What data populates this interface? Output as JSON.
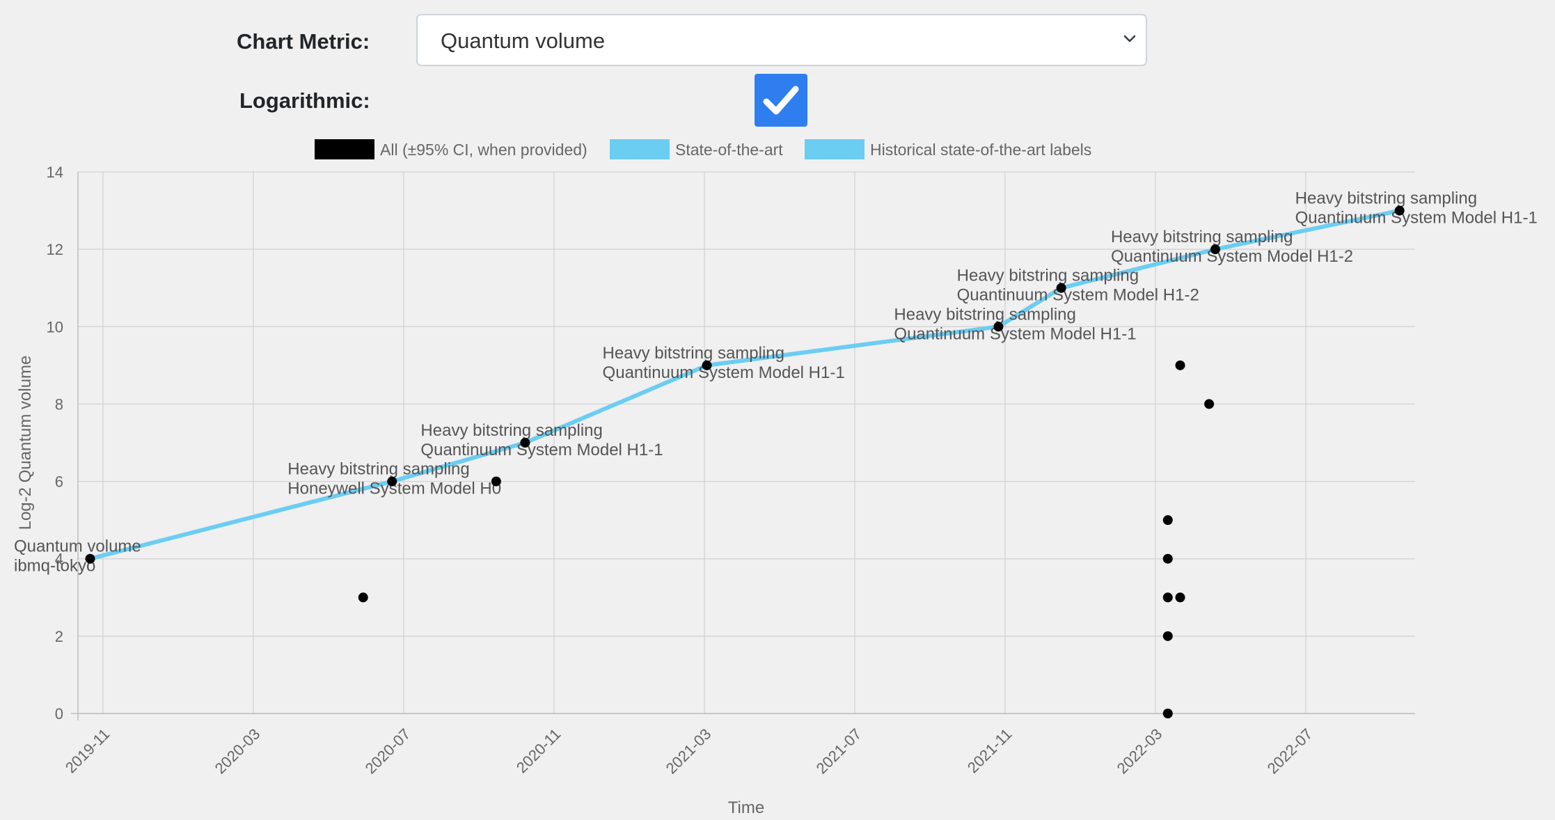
{
  "controls": {
    "metric_label": "Chart Metric:",
    "metric_value": "Quantum volume",
    "log_label": "Logarithmic:",
    "log_checked": true
  },
  "icons": {
    "select_caret": "chevron-down-icon",
    "checkbox": "check-icon"
  },
  "colors": {
    "sota": "#6ccdf2",
    "points": "#000000",
    "background": "#f0f0f0",
    "checkbox": "#2f7ef0"
  },
  "chart_data": {
    "type": "scatter",
    "xlabel": "Time",
    "ylabel": "Log-2 Quantum volume",
    "ylim": [
      0,
      14
    ],
    "yticks": [
      "0",
      "2",
      "4",
      "6",
      "8",
      "10",
      "12",
      "14"
    ],
    "xticks": [
      "2019-11",
      "2020-03",
      "2020-07",
      "2020-11",
      "2021-03",
      "2021-07",
      "2021-11",
      "2022-03",
      "2022-07"
    ],
    "grid": true,
    "legend": {
      "position": "top",
      "entries": [
        "All (±95% CI, when provided)",
        "State-of-the-art",
        "Historical state-of-the-art labels"
      ]
    },
    "series": [
      {
        "name": "All (±95% CI, when provided)",
        "points": [
          {
            "x": "2019-10-21",
            "y": 4
          },
          {
            "x": "2020-05-29",
            "y": 3
          },
          {
            "x": "2020-06-22",
            "y": 6
          },
          {
            "x": "2020-09-15",
            "y": 6
          },
          {
            "x": "2020-10-08",
            "y": 7
          },
          {
            "x": "2021-03-03",
            "y": 9
          },
          {
            "x": "2021-10-26",
            "y": 10
          },
          {
            "x": "2021-12-16",
            "y": 11
          },
          {
            "x": "2022-03-11",
            "y": 0
          },
          {
            "x": "2022-03-11",
            "y": 2
          },
          {
            "x": "2022-03-11",
            "y": 3
          },
          {
            "x": "2022-03-11",
            "y": 4
          },
          {
            "x": "2022-03-11",
            "y": 5
          },
          {
            "x": "2022-03-21",
            "y": 3
          },
          {
            "x": "2022-03-21",
            "y": 9
          },
          {
            "x": "2022-04-14",
            "y": 8
          },
          {
            "x": "2022-04-19",
            "y": 12
          },
          {
            "x": "2022-09-16",
            "y": 13
          }
        ]
      },
      {
        "name": "State-of-the-art",
        "points": [
          {
            "x": "2019-10-21",
            "y": 4
          },
          {
            "x": "2020-06-22",
            "y": 6
          },
          {
            "x": "2020-10-08",
            "y": 7
          },
          {
            "x": "2021-03-03",
            "y": 9
          },
          {
            "x": "2021-10-26",
            "y": 10
          },
          {
            "x": "2021-12-16",
            "y": 11
          },
          {
            "x": "2022-04-19",
            "y": 12
          },
          {
            "x": "2022-09-16",
            "y": 13
          }
        ]
      }
    ],
    "annotations": [
      {
        "x": "2019-10-21",
        "y": 4,
        "lines": [
          "Quantum volume",
          "ibmq-tokyo"
        ]
      },
      {
        "x": "2020-06-22",
        "y": 6,
        "lines": [
          "Heavy bitstring sampling",
          "Honeywell System Model H0"
        ]
      },
      {
        "x": "2020-10-08",
        "y": 7,
        "lines": [
          "Heavy bitstring sampling",
          "Quantinuum System Model H1-1"
        ]
      },
      {
        "x": "2021-03-03",
        "y": 9,
        "lines": [
          "Heavy bitstring sampling",
          "Quantinuum System Model H1-1"
        ]
      },
      {
        "x": "2021-10-26",
        "y": 10,
        "lines": [
          "Heavy bitstring sampling",
          "Quantinuum System Model H1-1"
        ]
      },
      {
        "x": "2021-12-16",
        "y": 11,
        "lines": [
          "Heavy bitstring sampling",
          "Quantinuum System Model H1-2"
        ]
      },
      {
        "x": "2022-04-19",
        "y": 12,
        "lines": [
          "Heavy bitstring sampling",
          "Quantinuum System Model H1-2"
        ]
      },
      {
        "x": "2022-09-16",
        "y": 13,
        "lines": [
          "Heavy bitstring sampling",
          "Quantinuum System Model H1-1"
        ]
      }
    ]
  }
}
